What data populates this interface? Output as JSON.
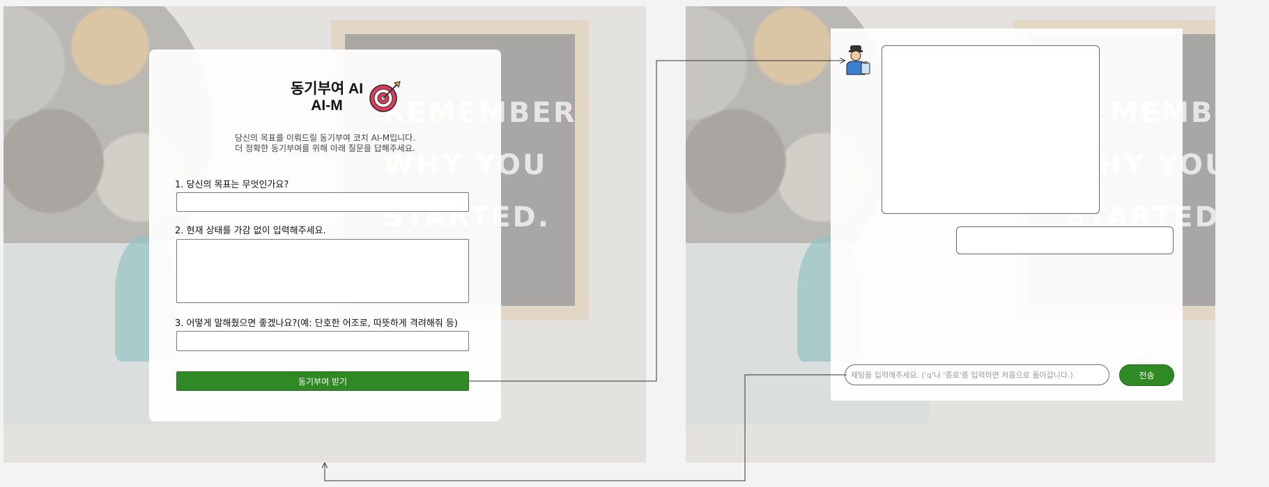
{
  "form": {
    "title_line1": "동기부여 AI",
    "title_line2": "AI-M",
    "target_icon": "target-dart-icon",
    "intro_line1": "당신의 목표를 이뤄드릴 동기부여 코치 AI-M입니다.",
    "intro_line2": "더 정확한 동기부여를 위해 아래 질문을 답해주세요.",
    "q1_label": "1. 당신의 목표는 무엇인가요?",
    "q1_value": "",
    "q2_label": "2. 현재 상태를 가감 없이 입력해주세요.",
    "q2_value": "",
    "q3_label": "3. 어떻게 말해줬으면 좋겠나요?(예: 단호한 어조로, 따뜻하게 격려해줘 등)",
    "q3_value": "",
    "submit_label": "동기부여 받기"
  },
  "chat": {
    "avatar_icon": "coach-avatar-icon",
    "bot_message": "",
    "user_message": "",
    "input_value": "",
    "input_placeholder": "채팅을 입력해주세요. ('q'나 '종료'를 입력하면 처음으로 돌아갑니다.)",
    "send_label": "전송"
  },
  "background": {
    "board_line1": "REMEMBER",
    "board_line2": "WHY YOU",
    "board_line3": "STARTED."
  },
  "colors": {
    "accent_green": "#2f8a25",
    "page_background": "#f3f3f3",
    "card_background": "#ffffff"
  }
}
